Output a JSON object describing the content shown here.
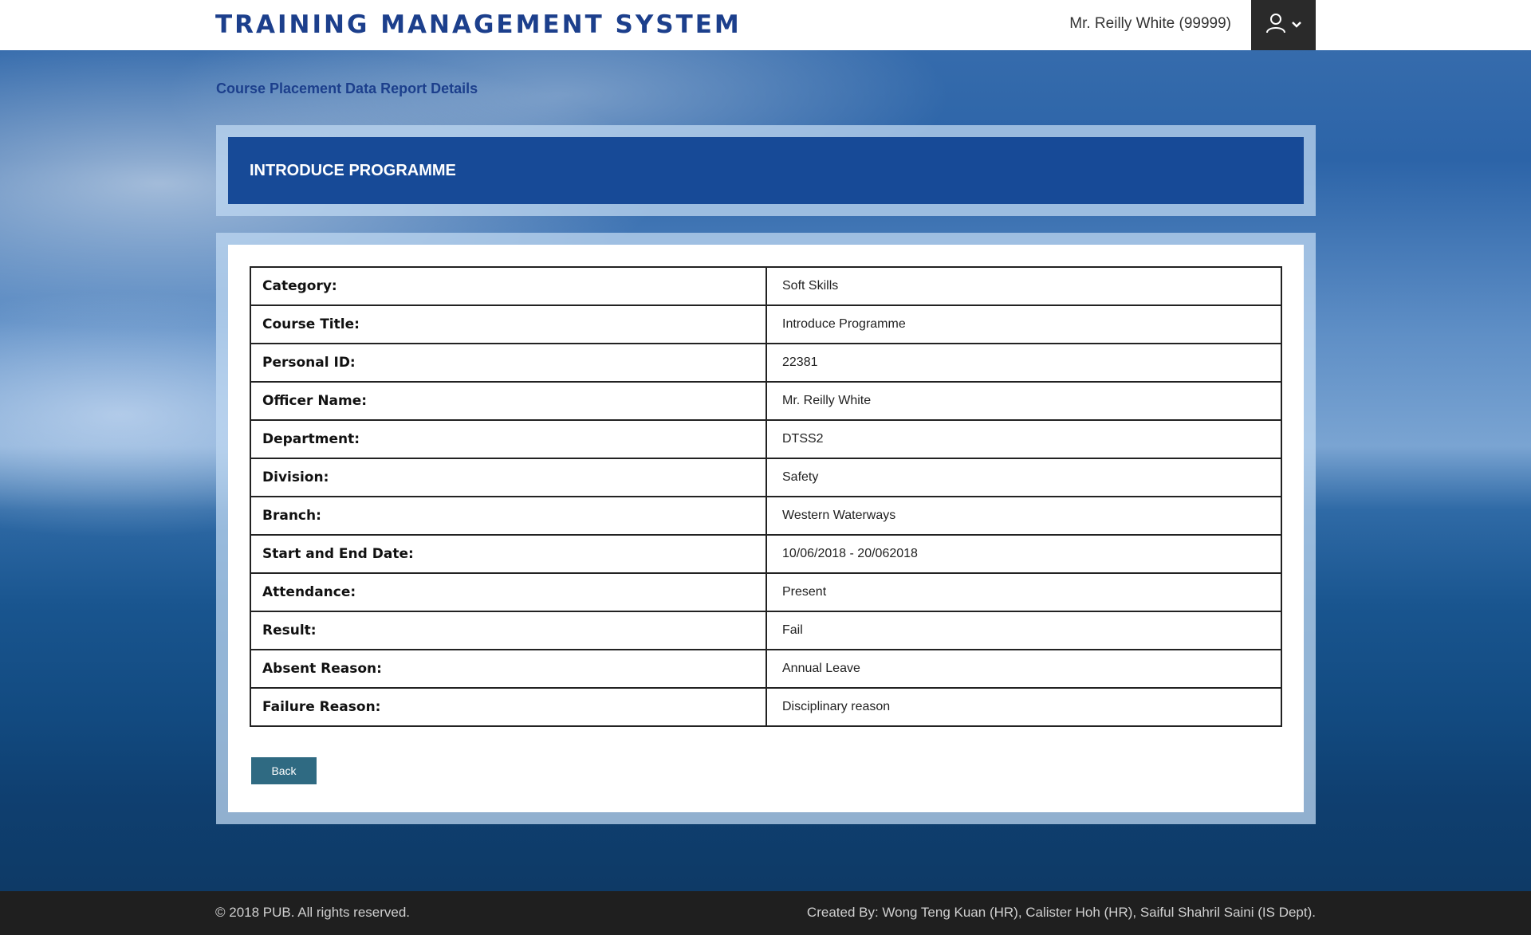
{
  "header": {
    "brand": "TRAINING MANAGEMENT SYSTEM",
    "user_display": "Mr. Reilly White (99999)",
    "user_icon": "user-icon",
    "menu_icon": "chevron-down-icon"
  },
  "page": {
    "title": "Course Placement Data Report Details",
    "programme_title": "INTRODUCE PROGRAMME"
  },
  "details": [
    {
      "label": "Category:",
      "value": "Soft Skills"
    },
    {
      "label": "Course Title:",
      "value": "Introduce Programme"
    },
    {
      "label": "Personal ID:",
      "value": "22381"
    },
    {
      "label": "Officer Name:",
      "value": "Mr. Reilly White"
    },
    {
      "label": "Department:",
      "value": "DTSS2"
    },
    {
      "label": "Division:",
      "value": "Safety"
    },
    {
      "label": "Branch:",
      "value": "Western Waterways"
    },
    {
      "label": "Start and End Date:",
      "value": "10/06/2018 - 20/062018"
    },
    {
      "label": "Attendance:",
      "value": "Present"
    },
    {
      "label": "Result:",
      "value": "Fail"
    },
    {
      "label": "Absent Reason:",
      "value": "Annual Leave"
    },
    {
      "label": "Failure Reason:",
      "value": "Disciplinary reason"
    }
  ],
  "actions": {
    "back_label": "Back"
  },
  "footer": {
    "copyright": "© 2018 PUB. All rights reserved.",
    "credits": "Created By: Wong Teng Kuan (HR), Calister Hoh (HR), Saiful Shahril Saini (IS Dept)."
  },
  "colors": {
    "brand": "#1c3f8c",
    "banner": "#174a97",
    "button": "#2f6a82",
    "footer": "#1f1f1f"
  }
}
